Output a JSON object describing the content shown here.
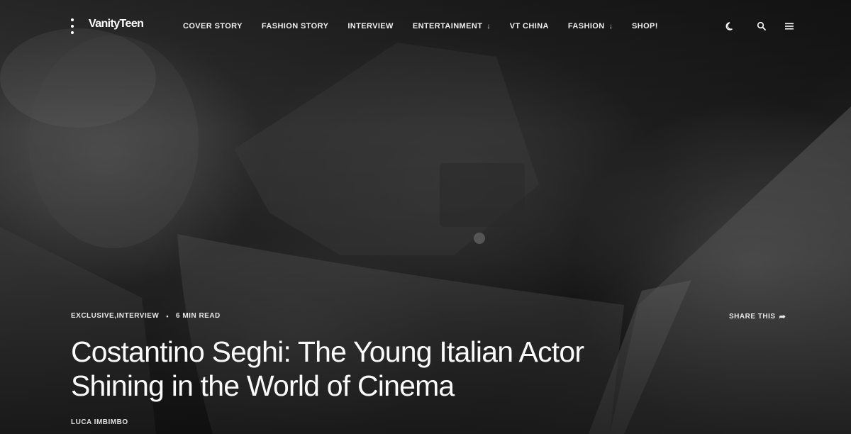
{
  "site": {
    "logo": "VanityTeen"
  },
  "nav": {
    "items": [
      {
        "label": "COVER STORY",
        "has_dropdown": false
      },
      {
        "label": "FASHION STORY",
        "has_dropdown": false
      },
      {
        "label": "INTERVIEW",
        "has_dropdown": false
      },
      {
        "label": "ENTERTAINMENT",
        "has_dropdown": true
      },
      {
        "label": "VT CHINA",
        "has_dropdown": false
      },
      {
        "label": "FASHION",
        "has_dropdown": true
      },
      {
        "label": "SHOP!",
        "has_dropdown": false
      }
    ],
    "dropdown_glyph": "↓"
  },
  "header_icons": [
    "dark-mode-moon-icon",
    "search-icon",
    "hamburger-menu-icon"
  ],
  "article": {
    "categories": "EXCLUSIVE,INTERVIEW",
    "bullet": "•",
    "read_time": "6 MIN READ",
    "share_label": "SHARE THIS",
    "share_glyph": "➦",
    "title": "Costantino Seghi: The Young Italian Actor Shining in the World of Cinema",
    "author": "LUCA IMBIMBO"
  },
  "colors": {
    "text": "#ffffff",
    "overlay": "#000000"
  }
}
